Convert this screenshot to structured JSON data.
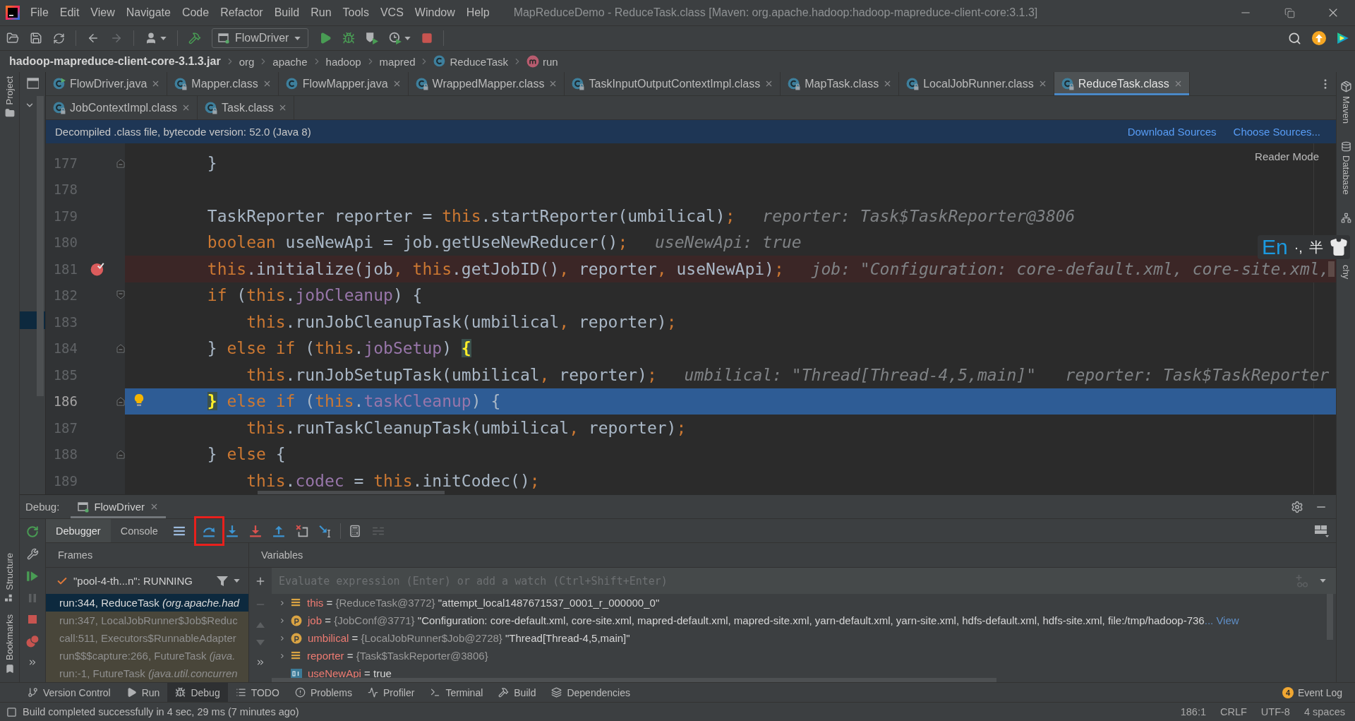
{
  "title_bar": {
    "menus": [
      "File",
      "Edit",
      "View",
      "Navigate",
      "Code",
      "Refactor",
      "Build",
      "Run",
      "Tools",
      "VCS",
      "Window",
      "Help"
    ],
    "title": "MapReduceDemo - ReduceTask.class [Maven: org.apache.hadoop:hadoop-mapreduce-client-core:3.1.3]"
  },
  "toolbar": {
    "run_configuration": "FlowDriver"
  },
  "breadcrumbs": [
    {
      "label": "hadoop-mapreduce-client-core-3.1.3.jar",
      "kind": "jar"
    },
    {
      "label": "org",
      "kind": "package"
    },
    {
      "label": "apache",
      "kind": "package"
    },
    {
      "label": "hadoop",
      "kind": "package"
    },
    {
      "label": "mapred",
      "kind": "package"
    },
    {
      "label": "ReduceTask",
      "kind": "class"
    },
    {
      "label": "run",
      "kind": "method"
    }
  ],
  "left_strip": {
    "top": [
      {
        "label": "Project",
        "kind": "project"
      }
    ],
    "bottom": [
      {
        "label": "Structure",
        "kind": "structure"
      },
      {
        "label": "Bookmarks",
        "kind": "bookmarks"
      }
    ]
  },
  "right_strip": [
    {
      "label": "Maven",
      "kind": "maven"
    },
    {
      "label": "Database",
      "kind": "database"
    },
    {
      "label": "chy",
      "kind": "hierarchy"
    }
  ],
  "editor_tabs": [
    {
      "tabs": [
        {
          "label": "FlowDriver.java",
          "kind": "main",
          "selected": false
        },
        {
          "label": "Mapper.class",
          "kind": "class",
          "selected": false
        },
        {
          "label": "FlowMapper.java",
          "kind": "java",
          "selected": false
        },
        {
          "label": "WrappedMapper.class",
          "kind": "class",
          "selected": false
        },
        {
          "label": "TaskInputOutputContextImpl.class",
          "kind": "class",
          "selected": false
        },
        {
          "label": "MapTask.class",
          "kind": "class",
          "selected": false
        },
        {
          "label": "LocalJobRunner.class",
          "kind": "class",
          "selected": false
        },
        {
          "label": "ReduceTask.class",
          "kind": "class",
          "selected": true
        }
      ]
    },
    {
      "tabs": [
        {
          "label": "JobContextImpl.class",
          "kind": "class",
          "selected": false
        },
        {
          "label": "Task.class",
          "kind": "class",
          "selected": false
        }
      ]
    }
  ],
  "banner": {
    "text": "Decompiled .class file, bytecode version: 52.0 (Java 8)",
    "links": [
      "Download Sources",
      "Choose Sources..."
    ]
  },
  "editor": {
    "reader_mode": "Reader Mode",
    "lines": [
      {
        "number": "177",
        "tokens": [
          {
            "kind": "plain",
            "text": "        }"
          }
        ],
        "breakpoint": false,
        "current": false,
        "bulb": false,
        "fold": {
          "kind": "end"
        }
      },
      {
        "number": "178",
        "breakpoint": false,
        "current": false,
        "bulb": false
      },
      {
        "number": "179",
        "tokens": [
          {
            "kind": "plain",
            "text": "        TaskReporter reporter = "
          },
          {
            "kind": "keyword",
            "text": "this"
          },
          {
            "kind": "plain",
            "text": ".startReporter(umbilical)"
          },
          {
            "kind": "keyword",
            "text": ";"
          }
        ],
        "hints": [
          "reporter: Task$TaskReporter@3806"
        ],
        "breakpoint": false,
        "current": false,
        "bulb": false
      },
      {
        "number": "180",
        "tokens": [
          {
            "kind": "keyword",
            "text": "        boolean"
          },
          {
            "kind": "plain",
            "text": " useNewApi = job.getUseNewReducer()"
          },
          {
            "kind": "keyword",
            "text": ";"
          }
        ],
        "hints": [
          "useNewApi: true"
        ],
        "breakpoint": false,
        "current": false,
        "bulb": false
      },
      {
        "number": "181",
        "tokens": [
          {
            "kind": "keyword",
            "text": "        this"
          },
          {
            "kind": "plain",
            "text": ".initialize(job"
          },
          {
            "kind": "keyword",
            "text": ", this"
          },
          {
            "kind": "plain",
            "text": ".getJobID()"
          },
          {
            "kind": "keyword",
            "text": ", "
          },
          {
            "kind": "plain",
            "text": "reporter"
          },
          {
            "kind": "keyword",
            "text": ", "
          },
          {
            "kind": "plain",
            "text": "useNewApi)"
          },
          {
            "kind": "keyword",
            "text": ";"
          }
        ],
        "hints": [
          "job: \"Configuration: core-default.xml, core-site.xml,"
        ],
        "breakpoint": true,
        "current": false,
        "bulb": false
      },
      {
        "number": "182",
        "tokens": [
          {
            "kind": "keyword",
            "text": "        if"
          },
          {
            "kind": "plain",
            "text": " ("
          },
          {
            "kind": "keyword",
            "text": "this"
          },
          {
            "kind": "plain",
            "text": "."
          },
          {
            "kind": "field",
            "text": "jobCleanup"
          },
          {
            "kind": "plain",
            "text": ") {"
          }
        ],
        "breakpoint": false,
        "current": false,
        "bulb": false,
        "fold": {
          "kind": "start"
        }
      },
      {
        "number": "183",
        "tokens": [
          {
            "kind": "keyword",
            "text": "            this"
          },
          {
            "kind": "plain",
            "text": ".runJobCleanupTask(umbilical"
          },
          {
            "kind": "keyword",
            "text": ", "
          },
          {
            "kind": "plain",
            "text": "reporter)"
          },
          {
            "kind": "keyword",
            "text": ";"
          }
        ],
        "breakpoint": false,
        "current": false,
        "bulb": false
      },
      {
        "number": "184",
        "tokens": [
          {
            "kind": "plain",
            "text": "        } "
          },
          {
            "kind": "keyword",
            "text": "else if"
          },
          {
            "kind": "plain",
            "text": " ("
          },
          {
            "kind": "keyword",
            "text": "this"
          },
          {
            "kind": "plain",
            "text": "."
          },
          {
            "kind": "field",
            "text": "jobSetup"
          },
          {
            "kind": "plain",
            "text": ") "
          },
          {
            "kind": "brace",
            "text": "{"
          }
        ],
        "breakpoint": false,
        "current": false,
        "bulb": false,
        "fold": {
          "kind": "end"
        }
      },
      {
        "number": "185",
        "tokens": [
          {
            "kind": "keyword",
            "text": "            this"
          },
          {
            "kind": "plain",
            "text": ".runJobSetupTask(umbilical"
          },
          {
            "kind": "keyword",
            "text": ", "
          },
          {
            "kind": "plain",
            "text": "reporter)"
          },
          {
            "kind": "keyword",
            "text": ";"
          }
        ],
        "hints": [
          "umbilical: \"Thread[Thread-4,5,main]\"",
          "reporter: Task$TaskReporter"
        ],
        "breakpoint": false,
        "current": false,
        "bulb": false
      },
      {
        "number": "186",
        "tokens": [
          {
            "kind": "brace",
            "text": "        }"
          },
          {
            "kind": "keyword",
            "text": " else if"
          },
          {
            "kind": "plain",
            "text": " ("
          },
          {
            "kind": "keyword",
            "text": "this"
          },
          {
            "kind": "plain",
            "text": "."
          },
          {
            "kind": "field",
            "text": "taskCleanup"
          },
          {
            "kind": "plain",
            "text": ") {"
          }
        ],
        "breakpoint": false,
        "current": true,
        "bulb": true,
        "fold": {
          "kind": "end"
        }
      },
      {
        "number": "187",
        "tokens": [
          {
            "kind": "keyword",
            "text": "            this"
          },
          {
            "kind": "plain",
            "text": ".runTaskCleanupTask(umbilical"
          },
          {
            "kind": "keyword",
            "text": ", "
          },
          {
            "kind": "plain",
            "text": "reporter)"
          },
          {
            "kind": "keyword",
            "text": ";"
          }
        ],
        "breakpoint": false,
        "current": false,
        "bulb": false
      },
      {
        "number": "188",
        "tokens": [
          {
            "kind": "plain",
            "text": "        } "
          },
          {
            "kind": "keyword",
            "text": "else"
          },
          {
            "kind": "plain",
            "text": " {"
          }
        ],
        "breakpoint": false,
        "current": false,
        "bulb": false,
        "fold": {
          "kind": "end"
        }
      },
      {
        "number": "189",
        "tokens": [
          {
            "kind": "keyword",
            "text": "            this"
          },
          {
            "kind": "plain",
            "text": "."
          },
          {
            "kind": "field",
            "text": "codec"
          },
          {
            "kind": "plain",
            "text": " = "
          },
          {
            "kind": "keyword",
            "text": "this"
          },
          {
            "kind": "plain",
            "text": ".initCodec()"
          },
          {
            "kind": "keyword",
            "text": ";"
          }
        ],
        "breakpoint": false,
        "current": false,
        "bulb": false
      }
    ]
  },
  "debug": {
    "title": "Debug:",
    "session": "FlowDriver",
    "side_actions": [
      {
        "kind": "rerun",
        "disabled": false
      },
      {
        "kind": "settings",
        "disabled": false
      },
      {
        "kind": "resume",
        "disabled": false
      },
      {
        "kind": "pause",
        "disabled": true
      },
      {
        "kind": "stop",
        "disabled": false
      },
      {
        "kind": "breakpoints",
        "disabled": false
      },
      {
        "kind": "more",
        "disabled": false
      }
    ],
    "tabs": [
      {
        "label": "Debugger",
        "selected": true
      },
      {
        "label": "Console",
        "selected": false
      }
    ],
    "actions": [
      {
        "kind": "frames_menu",
        "annotated": false,
        "disabled": false
      },
      {
        "kind": "step_over",
        "annotated": true,
        "disabled": false
      },
      {
        "kind": "step_into",
        "annotated": false,
        "disabled": false
      },
      {
        "kind": "force_step_into",
        "annotated": false,
        "disabled": false
      },
      {
        "kind": "step_out",
        "annotated": false,
        "disabled": false
      },
      {
        "kind": "drop_frame",
        "annotated": false,
        "disabled": false
      },
      {
        "kind": "run_to_cursor",
        "annotated": false,
        "disabled": false
      },
      {
        "kind": "evaluate",
        "annotated": false,
        "disabled": false
      },
      {
        "kind": "trace",
        "annotated": false,
        "disabled": true
      }
    ],
    "frames": {
      "header": "Frames",
      "thread": "\"pool-4-th...n\": RUNNING",
      "rows": [
        {
          "text": "run:344, ReduceTask *(org.apache.had*",
          "selected": true,
          "library": false
        },
        {
          "text": "run:347, LocalJobRunner$Job$Reduc",
          "selected": false,
          "library": true
        },
        {
          "text": "call:511, Executors$RunnableAdapter",
          "selected": false,
          "library": true
        },
        {
          "text": "run$$$capture:266, FutureTask *(java.*",
          "selected": false,
          "library": true
        },
        {
          "text": "run:-1, FutureTask *(java.util.concurren*",
          "selected": false,
          "library": true
        }
      ]
    },
    "variables": {
      "header": "Variables",
      "watch_actions": [
        {
          "kind": "add",
          "disabled": false
        },
        {
          "kind": "remove",
          "disabled": true
        },
        {
          "kind": "up",
          "disabled": true
        },
        {
          "kind": "down",
          "disabled": true
        },
        {
          "kind": "more",
          "disabled": false
        }
      ],
      "watch": {
        "placeholder": "Evaluate expression (Enter) or add a watch (Ctrl+Shift+Enter)"
      },
      "items": [
        {
          "kind": "object",
          "expandable": true,
          "name": "this",
          "assign": "=",
          "ref": "{ReduceTask@3772}",
          "value": "\"attempt_local1487671537_0001_r_000000_0\""
        },
        {
          "kind": "parameter",
          "expandable": true,
          "name": "job",
          "assign": "=",
          "ref": "{JobConf@3771}",
          "value": "\"Configuration: core-default.xml, core-site.xml, mapred-default.xml, mapred-site.xml, yarn-default.xml, yarn-site.xml, hdfs-default.xml, hdfs-site.xml, file:/tmp/hadoop-736",
          "link": "... View"
        },
        {
          "kind": "parameter",
          "expandable": true,
          "name": "umbilical",
          "assign": "=",
          "ref": "{LocalJobRunner$Job@2728}",
          "value": "\"Thread[Thread-4,5,main]\""
        },
        {
          "kind": "object",
          "expandable": true,
          "name": "reporter",
          "assign": "=",
          "ref": "{Task$TaskReporter@3806}"
        },
        {
          "kind": "boolean",
          "expandable": false,
          "name": "useNewApi",
          "assign": "=",
          "value": "true"
        }
      ]
    }
  },
  "tool_windows": [
    {
      "label": "Version Control",
      "kind": "vcs",
      "selected": false
    },
    {
      "label": "Run",
      "kind": "run",
      "selected": false
    },
    {
      "label": "Debug",
      "kind": "debug",
      "selected": true
    },
    {
      "label": "TODO",
      "kind": "todo",
      "selected": false
    },
    {
      "label": "Problems",
      "kind": "problems",
      "selected": false
    },
    {
      "label": "Profiler",
      "kind": "profiler",
      "selected": false
    },
    {
      "label": "Terminal",
      "kind": "terminal",
      "selected": false
    },
    {
      "label": "Build",
      "kind": "build",
      "selected": false
    },
    {
      "label": "Dependencies",
      "kind": "dependencies",
      "selected": false
    }
  ],
  "event_log": {
    "badge": "4",
    "label": "Event Log"
  },
  "status": {
    "message": "Build completed successfully in 4 sec, 29 ms (7 minutes ago)",
    "indicators": [
      "186:1",
      "CRLF",
      "UTF-8",
      "4 spaces"
    ]
  },
  "ime": {
    "mode": "En",
    "punctuation": "·,",
    "width_mode": "半"
  }
}
